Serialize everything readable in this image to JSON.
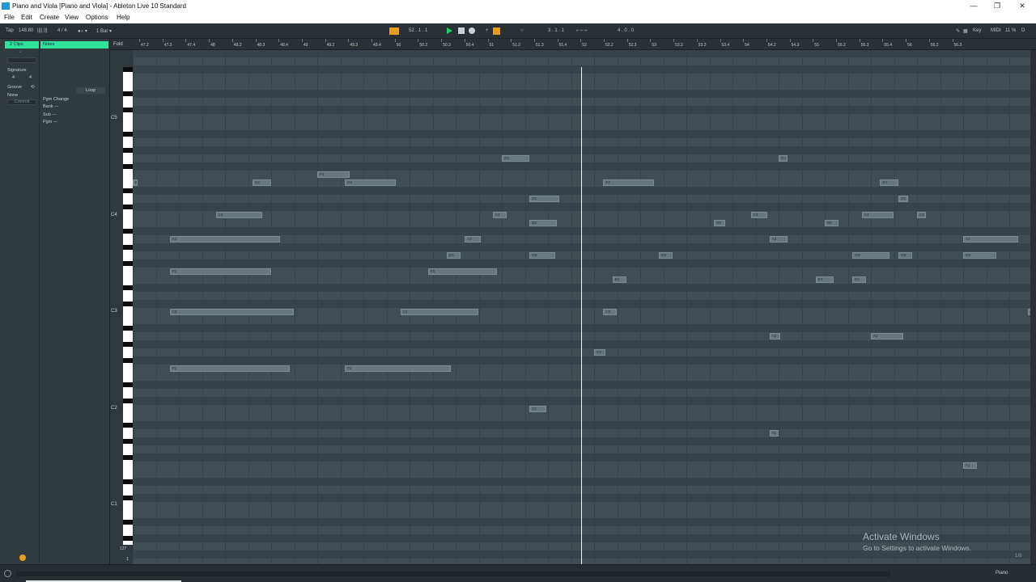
{
  "window": {
    "title": "Piano and Viola  [Piano and Viola] - Ableton Live 10 Standard",
    "minimize": "—",
    "restore": "❐",
    "close": "✕"
  },
  "menu": [
    "File",
    "Edit",
    "Create",
    "View",
    "Options",
    "Help"
  ],
  "control_bar": {
    "tap": "Tap",
    "tempo": "148.80",
    "meter_icon": "|||| |||",
    "signature": "4  /  4",
    "metronome": "●○ ▾",
    "quantize": "1 Bar ▾",
    "arrangement_position": "52 .  1 .  1",
    "punch_loop": "3 .  1 .  1",
    "loop_length": "4 .  0 .  0",
    "key_label": "Key",
    "midi_label": "MIDI",
    "cpu": "11 %",
    "accent_color": "#e5a021",
    "play_color": "#23d16b"
  },
  "clip_panel": {
    "clip_tab": "2 Clips",
    "notes_tab": "Notes",
    "signature_label": "Signature",
    "signature_num": "4",
    "signature_den": "4",
    "groove_label": "Groove",
    "groove_value": "None",
    "commit": "Commit",
    "loop_label": "Loop",
    "pgm_change_label": "Pgm Change",
    "bank": "Bank ---",
    "sub": "Sub ---",
    "pgm": "Pgm ---",
    "tab_color": "#2fe39b"
  },
  "ruler": {
    "fold_label": "Fold",
    "ticks": [
      "47.2",
      "47.3",
      "47.4",
      "48",
      "48.2",
      "48.3",
      "48.4",
      "49",
      "49.2",
      "49.3",
      "49.4",
      "50",
      "50.2",
      "50.3",
      "50.4",
      "51",
      "51.2",
      "51.3",
      "51.4",
      "52",
      "52.2",
      "52.3",
      "53",
      "53.2",
      "53.3",
      "53.4",
      "54",
      "54.2",
      "54.3",
      "55",
      "55.2",
      "55.3",
      "55.4",
      "56",
      "56.2",
      "56.3"
    ]
  },
  "octave_labels": [
    "C5",
    "C4",
    "C3",
    "C2",
    "C1"
  ],
  "bottom": {
    "range_label": "127",
    "range_value": "1",
    "piano_tag": "Piano",
    "page_indicator": "1/8"
  },
  "activation": {
    "title": "Activate Windows",
    "subtitle": "Go to Settings to activate Windows."
  },
  "notes": [
    {
      "label": "E",
      "pitch": 64,
      "start": 47.0,
      "dur": 0.05
    },
    {
      "label": "E4",
      "pitch": 64,
      "start": 48.3,
      "dur": 0.2
    },
    {
      "label": "F4",
      "pitch": 65,
      "start": 49.0,
      "dur": 0.35
    },
    {
      "label": "E4",
      "pitch": 64,
      "start": 49.3,
      "dur": 0.55
    },
    {
      "label": "G4",
      "pitch": 67,
      "start": 51.0,
      "dur": 0.3
    },
    {
      "label": "E4",
      "pitch": 64,
      "start": 52.1,
      "dur": 0.55
    },
    {
      "label": "D4",
      "pitch": 62,
      "start": 51.3,
      "dur": 0.32
    },
    {
      "label": "G4",
      "pitch": 67,
      "start": 54.0,
      "dur": 0.1
    },
    {
      "label": "E4",
      "pitch": 64,
      "start": 55.1,
      "dur": 0.2
    },
    {
      "label": "D4",
      "pitch": 62,
      "start": 55.3,
      "dur": 0.1
    },
    {
      "label": "C4",
      "pitch": 60,
      "start": 47.9,
      "dur": 0.5
    },
    {
      "label": "C4",
      "pitch": 60,
      "start": 50.9,
      "dur": 0.15
    },
    {
      "label": "C4",
      "pitch": 60,
      "start": 53.7,
      "dur": 0.18
    },
    {
      "label": "C4",
      "pitch": 60,
      "start": 54.9,
      "dur": 0.35
    },
    {
      "label": "C4",
      "pitch": 60,
      "start": 55.5,
      "dur": 0.1
    },
    {
      "label": "B3",
      "pitch": 59,
      "start": 51.3,
      "dur": 0.3
    },
    {
      "label": "B3",
      "pitch": 59,
      "start": 53.3,
      "dur": 0.12
    },
    {
      "label": "B3",
      "pitch": 59,
      "start": 54.5,
      "dur": 0.15
    },
    {
      "label": "A3",
      "pitch": 57,
      "start": 47.4,
      "dur": 1.2
    },
    {
      "label": "A3",
      "pitch": 57,
      "start": 50.6,
      "dur": 0.17
    },
    {
      "label": "A3",
      "pitch": 57,
      "start": 53.9,
      "dur": 0.2
    },
    {
      "label": "A3",
      "pitch": 57,
      "start": 56.0,
      "dur": 0.6
    },
    {
      "label": "G3",
      "pitch": 55,
      "start": 50.4,
      "dur": 0.15
    },
    {
      "label": "G3",
      "pitch": 55,
      "start": 51.3,
      "dur": 0.28
    },
    {
      "label": "G3",
      "pitch": 55,
      "start": 52.7,
      "dur": 0.15
    },
    {
      "label": "G3",
      "pitch": 55,
      "start": 54.8,
      "dur": 0.4
    },
    {
      "label": "G3",
      "pitch": 55,
      "start": 55.3,
      "dur": 0.15
    },
    {
      "label": "G3",
      "pitch": 55,
      "start": 56.0,
      "dur": 0.36
    },
    {
      "label": "F3",
      "pitch": 53,
      "start": 47.4,
      "dur": 1.1
    },
    {
      "label": "F3",
      "pitch": 53,
      "start": 50.2,
      "dur": 0.75
    },
    {
      "label": "E3",
      "pitch": 52,
      "start": 52.2,
      "dur": 0.15
    },
    {
      "label": "E3",
      "pitch": 52,
      "start": 54.4,
      "dur": 0.2
    },
    {
      "label": "E3",
      "pitch": 52,
      "start": 54.8,
      "dur": 0.15
    },
    {
      "label": "D3",
      "pitch": 50,
      "start": 56.9,
      "dur": 0.15
    },
    {
      "label": "C3",
      "pitch": 48,
      "start": 47.4,
      "dur": 1.35
    },
    {
      "label": "C3",
      "pitch": 48,
      "start": 49.9,
      "dur": 0.85
    },
    {
      "label": "C3",
      "pitch": 48,
      "start": 52.1,
      "dur": 0.15
    },
    {
      "label": "C3",
      "pitch": 48,
      "start": 56.7,
      "dur": 0.4
    },
    {
      "label": "A2",
      "pitch": 45,
      "start": 53.9,
      "dur": 0.12
    },
    {
      "label": "A2",
      "pitch": 45,
      "start": 55.0,
      "dur": 0.35
    },
    {
      "label": "G2",
      "pitch": 43,
      "start": 52.0,
      "dur": 0.12
    },
    {
      "label": "F2",
      "pitch": 41,
      "start": 47.4,
      "dur": 1.3
    },
    {
      "label": "F2",
      "pitch": 41,
      "start": 49.3,
      "dur": 1.15
    },
    {
      "label": "C2",
      "pitch": 36,
      "start": 51.3,
      "dur": 0.18
    },
    {
      "label": "A1",
      "pitch": 33,
      "start": 53.9,
      "dur": 0.1
    },
    {
      "label": "F1",
      "pitch": 29,
      "start": 56.0,
      "dur": 0.15
    }
  ]
}
